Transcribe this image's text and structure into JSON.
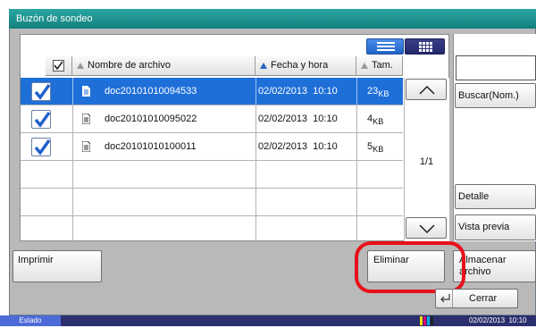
{
  "window": {
    "title": "Buzón de sondeo"
  },
  "view_toggle": {
    "list_icon": "list-view-icon",
    "grid_icon": "grid-view-icon"
  },
  "columns": {
    "name": "Nombre de archivo",
    "date": "Fecha y hora",
    "size": "Tam."
  },
  "files": [
    {
      "name": "doc20101010094533",
      "date": "02/02/2013  10:10",
      "size": "23",
      "unit": "KB",
      "checked": true,
      "selected": true
    },
    {
      "name": "doc20101010095022",
      "date": "02/02/2013  10:10",
      "size": "4",
      "unit": "KB",
      "checked": true,
      "selected": false
    },
    {
      "name": "doc20101010100011",
      "date": "02/02/2013  10:10",
      "size": "5",
      "unit": "KB",
      "checked": true,
      "selected": false
    }
  ],
  "pagination": {
    "page": "1/1"
  },
  "side": {
    "search_value": "",
    "search_label": "Buscar(Nom.)",
    "detail_label": "Detalle",
    "preview_label": "Vista previa"
  },
  "actions": {
    "print_label": "Imprimir",
    "delete_label": "Eliminar",
    "store_label_1": "Almacenar",
    "store_label_2": "archivo",
    "close_label": "Cerrar"
  },
  "status_bar": {
    "status_label": "Estado",
    "datetime": "02/02/2013  10:10"
  },
  "colors": {
    "title": "#1a8f8c",
    "selected_row": "#1f6fd8",
    "highlight_ring": "#e8101a",
    "status_bar": "#2b2f6e"
  }
}
